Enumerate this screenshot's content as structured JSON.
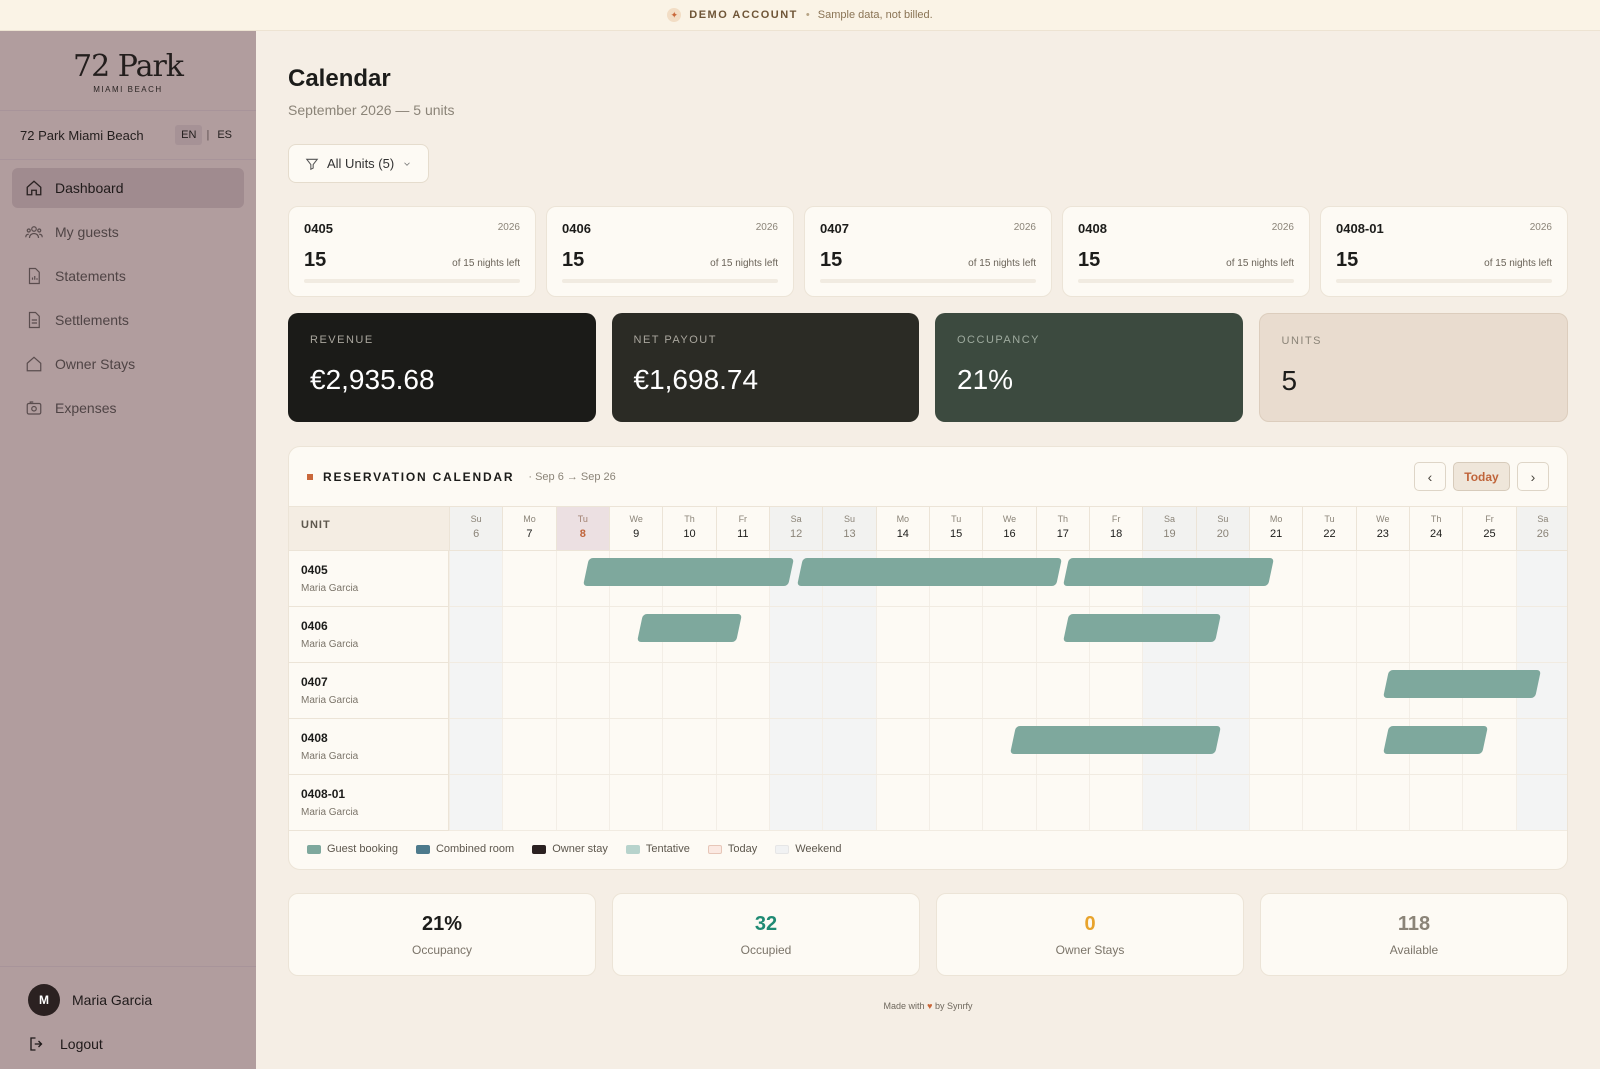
{
  "banner": {
    "title": "DEMO ACCOUNT",
    "sep": "•",
    "text": "Sample data, not billed."
  },
  "sidebar": {
    "logo_main": "72 Park",
    "logo_sub": "MIAMI BEACH",
    "property": "72 Park Miami Beach",
    "lang": {
      "en": "EN",
      "sep": "|",
      "es": "ES"
    },
    "items": [
      {
        "label": "Dashboard",
        "icon": "home-icon",
        "active": true
      },
      {
        "label": "My guests",
        "icon": "users-icon"
      },
      {
        "label": "Statements",
        "icon": "report-icon"
      },
      {
        "label": "Settlements",
        "icon": "document-icon"
      },
      {
        "label": "Owner Stays",
        "icon": "house-icon"
      },
      {
        "label": "Expenses",
        "icon": "wallet-icon"
      }
    ],
    "user": {
      "initial": "M",
      "name": "Maria Garcia"
    },
    "logout": "Logout"
  },
  "header": {
    "title": "Calendar",
    "subtitle": "September 2026 — 5 units"
  },
  "filter": {
    "label": "All Units (5)"
  },
  "unit_cards": [
    {
      "name": "0405",
      "year": "2026",
      "nights": "15",
      "left": "of 15 nights left"
    },
    {
      "name": "0406",
      "year": "2026",
      "nights": "15",
      "left": "of 15 nights left"
    },
    {
      "name": "0407",
      "year": "2026",
      "nights": "15",
      "left": "of 15 nights left"
    },
    {
      "name": "0408",
      "year": "2026",
      "nights": "15",
      "left": "of 15 nights left"
    },
    {
      "name": "0408-01",
      "year": "2026",
      "nights": "15",
      "left": "of 15 nights left"
    }
  ],
  "kpis": [
    {
      "label": "REVENUE",
      "value": "€2,935.68"
    },
    {
      "label": "NET PAYOUT",
      "value": "€1,698.74"
    },
    {
      "label": "OCCUPANCY",
      "value": "21%"
    },
    {
      "label": "UNITS",
      "value": "5"
    }
  ],
  "calendar": {
    "title": "RESERVATION CALENDAR",
    "range": "· Sep 6 → Sep 26",
    "prev": "‹",
    "today": "Today",
    "next": "›",
    "unit_header": "UNIT",
    "days": [
      {
        "dw": "Su",
        "dn": "6",
        "weekend": true
      },
      {
        "dw": "Mo",
        "dn": "7"
      },
      {
        "dw": "Tu",
        "dn": "8",
        "today": true
      },
      {
        "dw": "We",
        "dn": "9"
      },
      {
        "dw": "Th",
        "dn": "10"
      },
      {
        "dw": "Fr",
        "dn": "11"
      },
      {
        "dw": "Sa",
        "dn": "12",
        "weekend": true
      },
      {
        "dw": "Su",
        "dn": "13",
        "weekend": true
      },
      {
        "dw": "Mo",
        "dn": "14"
      },
      {
        "dw": "Tu",
        "dn": "15"
      },
      {
        "dw": "We",
        "dn": "16"
      },
      {
        "dw": "Th",
        "dn": "17"
      },
      {
        "dw": "Fr",
        "dn": "18"
      },
      {
        "dw": "Sa",
        "dn": "19",
        "weekend": true
      },
      {
        "dw": "Su",
        "dn": "20",
        "weekend": true
      },
      {
        "dw": "Mo",
        "dn": "21"
      },
      {
        "dw": "Tu",
        "dn": "22"
      },
      {
        "dw": "We",
        "dn": "23"
      },
      {
        "dw": "Th",
        "dn": "24"
      },
      {
        "dw": "Fr",
        "dn": "25"
      },
      {
        "dw": "Sa",
        "dn": "26",
        "weekend": true
      }
    ],
    "units": [
      {
        "name": "0405",
        "owner": "Maria Garcia",
        "bookings": [
          [
            8,
            12
          ],
          [
            12,
            17
          ],
          [
            17,
            21
          ]
        ]
      },
      {
        "name": "0406",
        "owner": "Maria Garcia",
        "bookings": [
          [
            9,
            11
          ],
          [
            17,
            20
          ]
        ]
      },
      {
        "name": "0407",
        "owner": "Maria Garcia",
        "bookings": [
          [
            23,
            26
          ]
        ]
      },
      {
        "name": "0408",
        "owner": "Maria Garcia",
        "bookings": [
          [
            16,
            20
          ],
          [
            23,
            25
          ]
        ]
      },
      {
        "name": "0408-01",
        "owner": "Maria Garcia",
        "bookings": []
      }
    ],
    "legend": [
      {
        "label": "Guest booking",
        "color": "#7ea89d"
      },
      {
        "label": "Combined room",
        "color": "#4d7a8c"
      },
      {
        "label": "Owner stay",
        "color": "#2b2121"
      },
      {
        "label": "Tentative",
        "color": "#b7d3cc"
      },
      {
        "label": "Today",
        "color": "#fbe9e2"
      },
      {
        "label": "Weekend",
        "color": "#f1f2f3"
      }
    ]
  },
  "stats": [
    {
      "value": "21%",
      "label": "Occupancy",
      "color": "#1c1c1a"
    },
    {
      "value": "32",
      "label": "Occupied",
      "color": "#1f8a73"
    },
    {
      "value": "0",
      "label": "Owner Stays",
      "color": "#e8a32c"
    },
    {
      "value": "118",
      "label": "Available",
      "color": "#8b8478"
    }
  ],
  "footer": {
    "pre": "Made with",
    "heart": "♥",
    "post": "by Synrfy"
  }
}
